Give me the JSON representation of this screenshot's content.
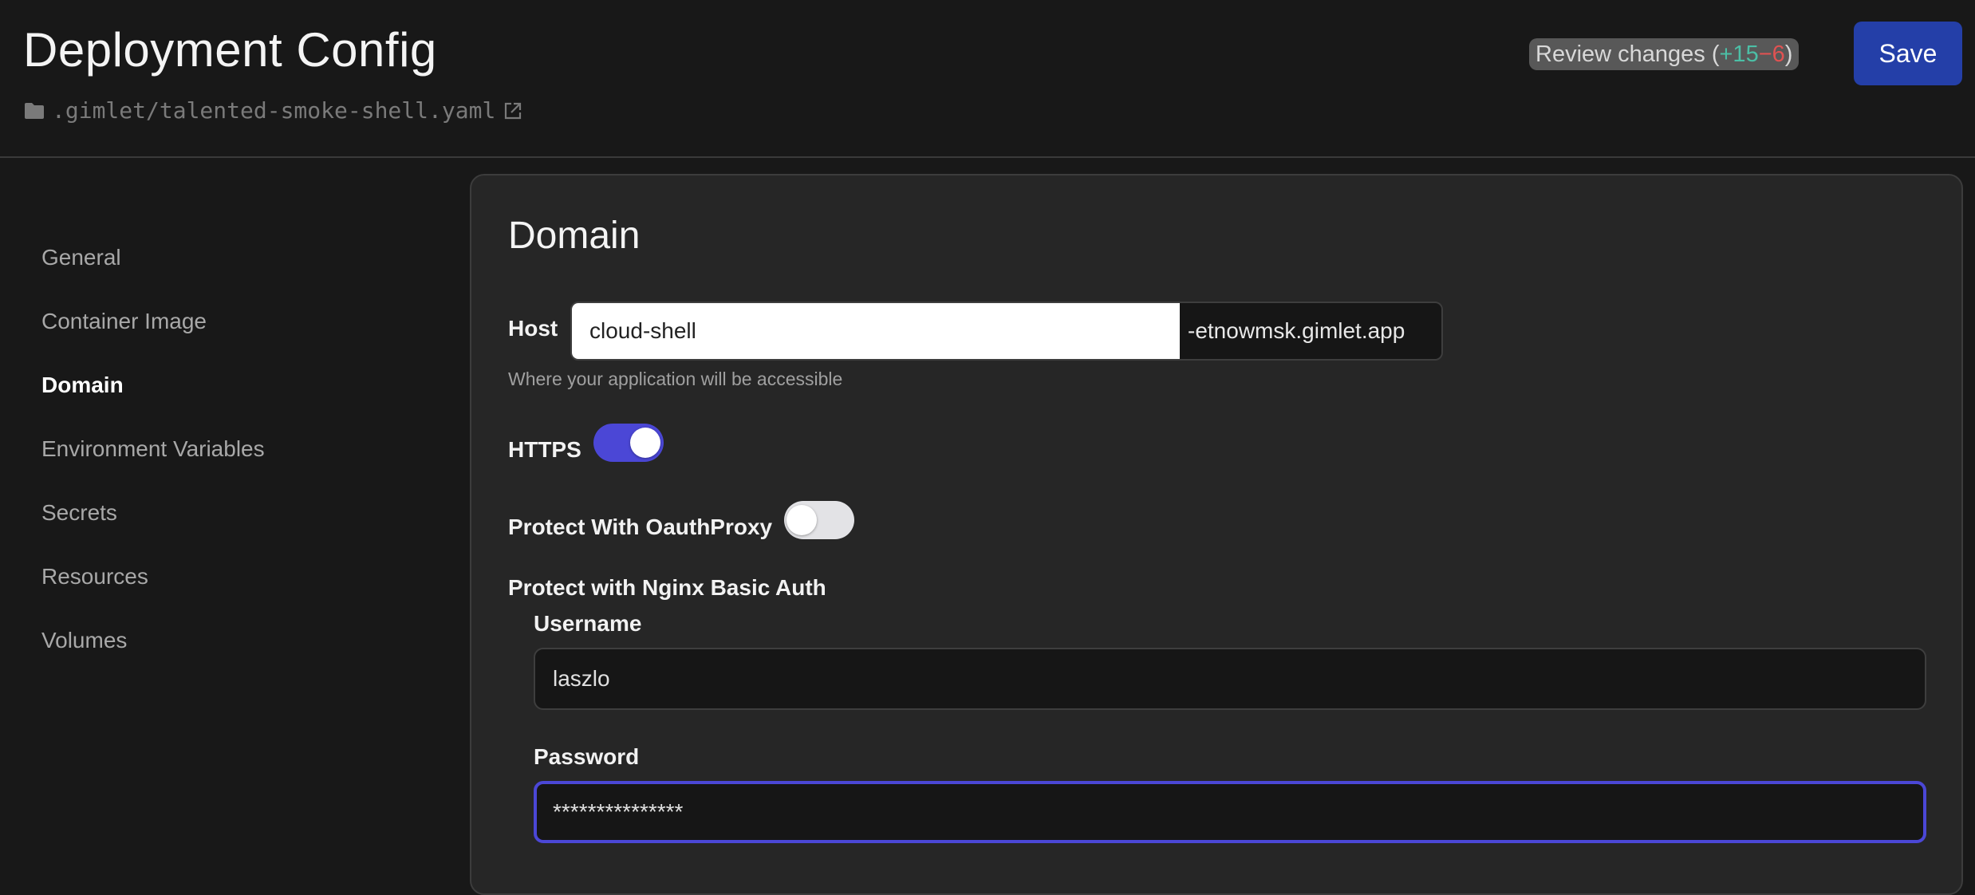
{
  "header": {
    "title": "Deployment Config",
    "file_path": ".gimlet/talented-smoke-shell.yaml",
    "review": {
      "label": "Review changes (",
      "additions": "+15",
      "deletions": "−6",
      "close": ")"
    },
    "save_label": "Save"
  },
  "sidebar": {
    "items": [
      {
        "label": "General",
        "active": false
      },
      {
        "label": "Container Image",
        "active": false
      },
      {
        "label": "Domain",
        "active": true
      },
      {
        "label": "Environment Variables",
        "active": false
      },
      {
        "label": "Secrets",
        "active": false
      },
      {
        "label": "Resources",
        "active": false
      },
      {
        "label": "Volumes",
        "active": false
      }
    ]
  },
  "domain": {
    "title": "Domain",
    "host": {
      "label": "Host",
      "value": "cloud-shell",
      "suffix": "-etnowmsk.gimlet.app",
      "help": "Where your application will be accessible"
    },
    "https": {
      "label": "HTTPS",
      "enabled": true
    },
    "oauth_proxy": {
      "label": "Protect With OauthProxy",
      "enabled": false
    },
    "basic_auth": {
      "label": "Protect with Nginx Basic Auth",
      "username_label": "Username",
      "username_value": "laszlo",
      "password_label": "Password",
      "password_value": "***************"
    }
  },
  "colors": {
    "accent": "#4b47d6",
    "save_button": "#243fa8",
    "additions": "#4cbfa6",
    "deletions": "#e05252"
  }
}
